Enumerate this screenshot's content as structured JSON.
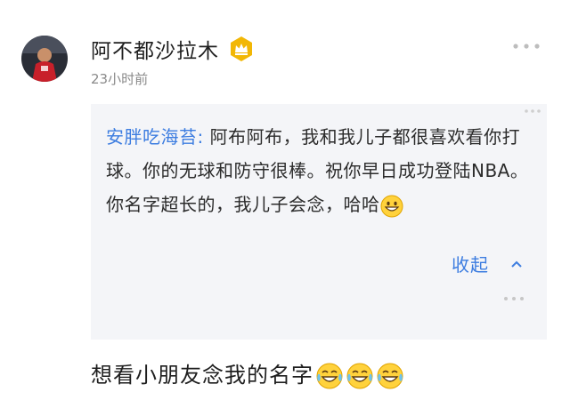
{
  "comment": {
    "username": "阿不都沙拉木",
    "badge_icon": "crown-vip-icon",
    "time": "23小时前",
    "more_icon": "more-dots-icon"
  },
  "quote": {
    "author": "安胖吃海苔:",
    "text": " 阿布阿布，我和我儿子都很喜欢看你打球。你的无球和防守很棒。祝你早日成功登陆NBA。你名字超长的，我儿子会念，哈哈",
    "emoji": "grinning-face-emoji",
    "collapse_label": "收起",
    "collapse_icon": "chevron-up-icon"
  },
  "reply": {
    "text": "想看小朋友念我的名字",
    "emojis": [
      "tears-of-joy-emoji",
      "tears-of-joy-emoji",
      "tears-of-joy-emoji"
    ]
  },
  "colors": {
    "link_blue": "#3d7de0",
    "quote_bg": "#f4f5f8",
    "badge_gold": "#f2b705",
    "muted": "#8a8a8a"
  }
}
